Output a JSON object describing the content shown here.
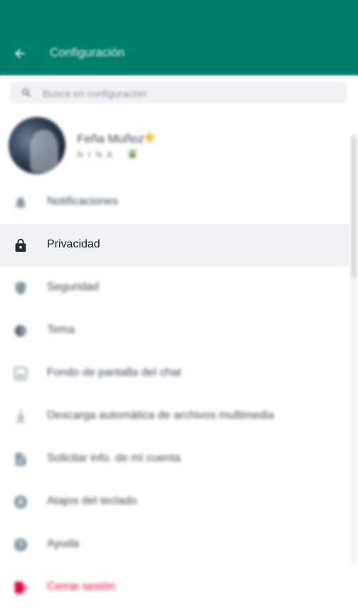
{
  "colors": {
    "header_bg": "#008069",
    "danger": "#ea0038",
    "active_row": "#f0f2f5"
  },
  "header": {
    "back_icon": "arrow-left-icon",
    "title": "Configuración"
  },
  "search": {
    "icon": "search-icon",
    "placeholder": "Busca en configuración"
  },
  "profile": {
    "name": "Feña Muñoz",
    "about": "N I N A",
    "badges": [
      "star-icon",
      "lock-icon"
    ]
  },
  "menu": {
    "items": [
      {
        "icon": "bell-icon",
        "label": "Notificaciones"
      },
      {
        "icon": "lock-icon",
        "label": "Privacidad",
        "active": true
      },
      {
        "icon": "shield-icon",
        "label": "Seguridad"
      },
      {
        "icon": "theme-icon",
        "label": "Tema"
      },
      {
        "icon": "wallpaper-icon",
        "label": "Fondo de pantalla del chat"
      },
      {
        "icon": "download-icon",
        "label": "Descarga automática de archivos multimedia"
      },
      {
        "icon": "document-icon",
        "label": "Solicitar info. de mi cuenta"
      },
      {
        "icon": "keyboard-icon",
        "label": "Atajos del teclado"
      },
      {
        "icon": "help-icon",
        "label": "Ayuda"
      },
      {
        "icon": "logout-icon",
        "label": "Cerrar sesión"
      }
    ]
  }
}
